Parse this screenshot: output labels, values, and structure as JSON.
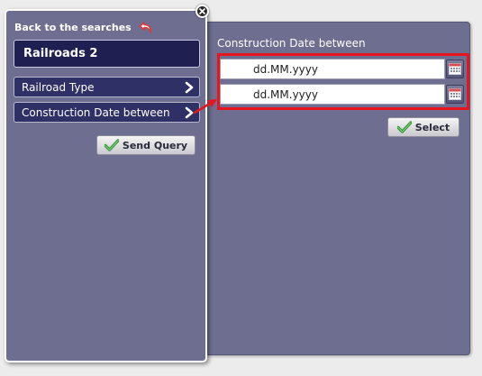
{
  "sidebar": {
    "back_label": "Back to the searches",
    "title": "Railroads 2",
    "items": [
      {
        "label": "Railroad Type"
      },
      {
        "label": "Construction Date between"
      }
    ],
    "send_query_label": "Send Query"
  },
  "detail": {
    "label": "Construction Date between",
    "from_value": "dd.MM.yyyy",
    "to_value": "dd.MM.yyyy",
    "select_label": "Select"
  },
  "colors": {
    "panel": "#6e6f90",
    "title_bg": "#1f1f52",
    "menu_bg": "#2f3066",
    "highlight": "#e8141e",
    "check": "#3aa53a",
    "back_arrow": "#d83a3a"
  }
}
